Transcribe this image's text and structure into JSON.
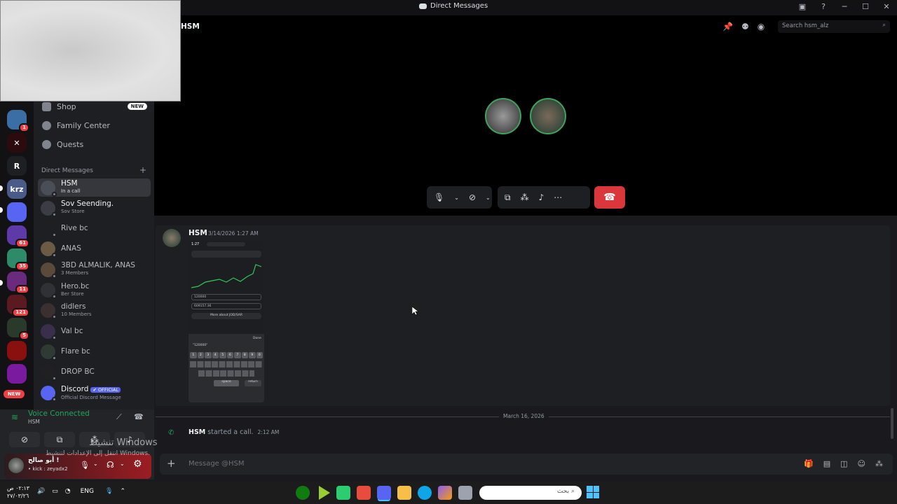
{
  "window": {
    "title": "Direct Messages"
  },
  "servers": [
    {
      "badge": "1",
      "color": "#3b6ea5"
    },
    {
      "badge": "",
      "color": "#2b0b0d",
      "glyph": "✕"
    },
    {
      "badge": "",
      "color": "#1e1f22",
      "glyph": "R"
    },
    {
      "badge": "",
      "color": "#4a5b8a",
      "glyph": "krz"
    },
    {
      "badge": "",
      "color": "#5865f2",
      "glyph": ""
    },
    {
      "badge": "61",
      "color": "#5e3aa8"
    },
    {
      "badge": "35",
      "color": "#2e8b6a"
    },
    {
      "badge": "11",
      "color": "#6a2a7e"
    },
    {
      "badge": "121",
      "color": "#5a1a1f"
    },
    {
      "badge": "5",
      "color": "#2a3a2a"
    },
    {
      "badge": "",
      "color": "#8a1010"
    },
    {
      "badge": "",
      "color": "#7a1a9e"
    }
  ],
  "rail_new": "NEW",
  "sidebar": {
    "menu": [
      {
        "label": "Shop",
        "badge": "NEW"
      },
      {
        "label": "Family Center"
      },
      {
        "label": "Quests"
      }
    ],
    "dm_header": "Direct Messages",
    "dm_add": "+",
    "dms": [
      {
        "name": "HSM",
        "sub": "In a call",
        "active": true,
        "color": "#4a4f57"
      },
      {
        "name": "Sov Seending.",
        "sub": "Sov Store",
        "bright": true,
        "color": "#3a3d44"
      },
      {
        "name": "Rive bc",
        "sub": "",
        "color": "#1e1f22"
      },
      {
        "name": "ANAS",
        "sub": "",
        "color": "#6b5a44"
      },
      {
        "name": "3BD ALMALIK, ANAS",
        "sub": "3 Members",
        "color": "#5a4a3a"
      },
      {
        "name": "Hero.bc",
        "sub": "Ber Store",
        "color": "#2f3136"
      },
      {
        "name": "didlers",
        "sub": "10 Members",
        "color": "#3a3030"
      },
      {
        "name": "Val bc",
        "sub": "",
        "color": "#3a2f4a"
      },
      {
        "name": "Flare bc",
        "sub": "",
        "color": "#2f3a35"
      },
      {
        "name": "DROP BC",
        "sub": "",
        "color": "#202022"
      },
      {
        "name": "Discord",
        "sub": "Official Discord Message",
        "official": "✔ OFFICIAL",
        "bright": true,
        "color": "#5865f2"
      }
    ]
  },
  "voice": {
    "status": "Voice Connected",
    "channel": "HSM"
  },
  "user": {
    "display": "أبو صالح !",
    "status": "• kick : zeyadx2"
  },
  "watermark": {
    "line1": "تنشيط Windows",
    "line2": "انتقل إلى الإعدادات لتنشيط Windows."
  },
  "call": {
    "name": "HSM",
    "search_placeholder": "Search hsm_alz"
  },
  "messages": [
    {
      "author": "HSM",
      "time": "3/14/2026 1:27 AM"
    }
  ],
  "date_divider": "March 16, 2026",
  "system_message": {
    "author": "HSM",
    "text": "started a call.",
    "time": "2:12 AM"
  },
  "composer": {
    "placeholder": "Message @HSM"
  },
  "phone_shot": {
    "clock": "1:27",
    "field1": "120000",
    "field2": "609157.36",
    "more": "More about JOD/SAR",
    "typed": "\"120000\"",
    "done": "Done",
    "keys": [
      "1",
      "2",
      "3",
      "4",
      "5",
      "6",
      "7",
      "8",
      "9",
      "0"
    ],
    "space": "space",
    "return": "return"
  },
  "taskbar": {
    "time": "٠٢:١٣ ص",
    "date": "٢٧/٠٣/٢٦",
    "lang": "ENG",
    "search": "بحث"
  }
}
